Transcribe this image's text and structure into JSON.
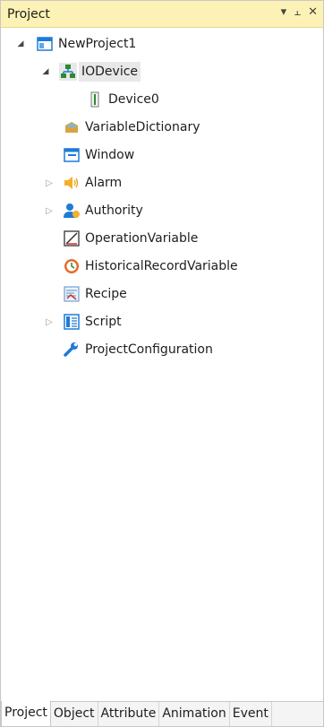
{
  "panel": {
    "title": "Project",
    "pin_glyph": "⫠",
    "close_glyph": "✕",
    "dropdown_glyph": "▾"
  },
  "tree": {
    "root": {
      "label": "NewProject1",
      "expanded": true,
      "icon": "project-window-icon"
    },
    "iodevice": {
      "label": "IODevice",
      "expanded": true,
      "selected": true,
      "icon": "network-icon"
    },
    "device0": {
      "label": "Device0",
      "icon": "device-icon"
    },
    "variable_dictionary": {
      "label": "VariableDictionary",
      "icon": "dictionary-icon"
    },
    "window": {
      "label": "Window",
      "icon": "window-icon"
    },
    "alarm": {
      "label": "Alarm",
      "expanded": false,
      "icon": "speaker-icon"
    },
    "authority": {
      "label": "Authority",
      "expanded": false,
      "icon": "user-icon"
    },
    "operation_variable": {
      "label": "OperationVariable",
      "icon": "chart-icon"
    },
    "historical_record_variable": {
      "label": "HistoricalRecordVariable",
      "icon": "clock-icon"
    },
    "recipe": {
      "label": "Recipe",
      "icon": "recipe-icon"
    },
    "script": {
      "label": "Script",
      "expanded": false,
      "icon": "script-icon"
    },
    "project_configuration": {
      "label": "ProjectConfiguration",
      "icon": "wrench-icon"
    }
  },
  "tabs": [
    {
      "label": "Project",
      "active": true
    },
    {
      "label": "Object"
    },
    {
      "label": "Attribute"
    },
    {
      "label": "Animation"
    },
    {
      "label": "Event"
    }
  ],
  "colors": {
    "titlebar_bg": "#fdf2b5",
    "selection_bg": "#e8e8e8",
    "accent_blue": "#1e7bd6"
  }
}
